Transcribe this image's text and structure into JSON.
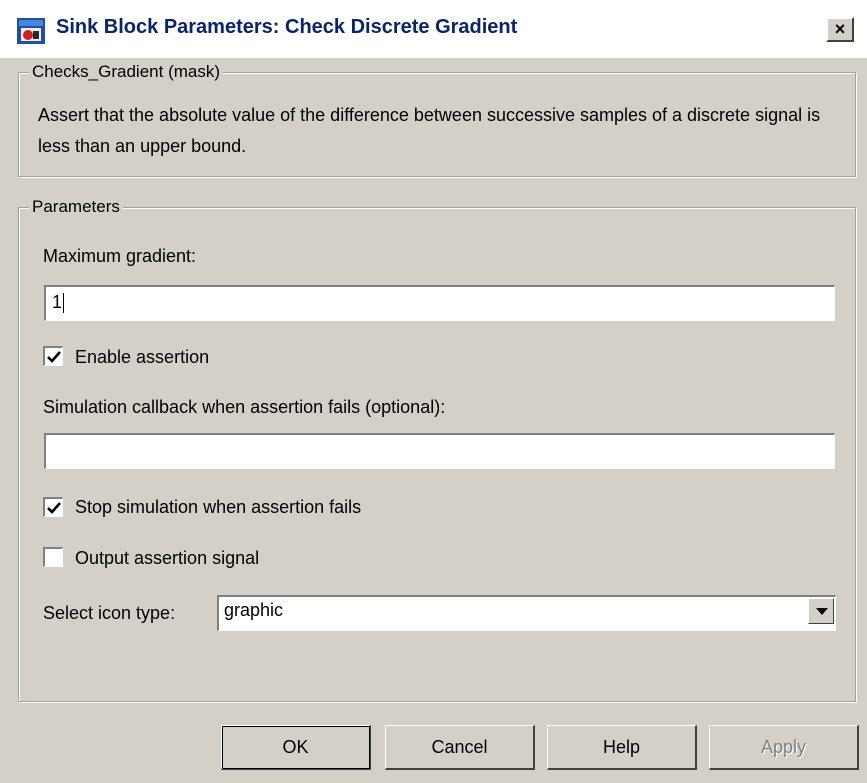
{
  "window": {
    "title": "Sink Block Parameters: Check Discrete Gradient",
    "close_label": "×"
  },
  "mask_group": {
    "legend": "Checks_Gradient (mask)",
    "description": "Assert that the absolute value of the difference between successive samples of a discrete signal is less than an upper bound."
  },
  "parameters": {
    "legend": "Parameters",
    "max_gradient": {
      "label": "Maximum gradient:",
      "value": "1"
    },
    "enable_assertion": {
      "label": "Enable assertion",
      "checked": true
    },
    "callback": {
      "label": "Simulation callback when assertion fails (optional):",
      "value": ""
    },
    "stop_simulation": {
      "label": "Stop simulation when assertion fails",
      "checked": true
    },
    "output_signal": {
      "label": "Output assertion signal",
      "checked": false
    },
    "icon_type": {
      "label": "Select icon type:",
      "value": "graphic"
    }
  },
  "buttons": {
    "ok": "OK",
    "cancel": "Cancel",
    "help": "Help",
    "apply": "Apply"
  },
  "icons": {
    "window_icon": "simulink-block-icon",
    "check": "checkmark-icon",
    "dropdown": "chevron-down-icon"
  }
}
